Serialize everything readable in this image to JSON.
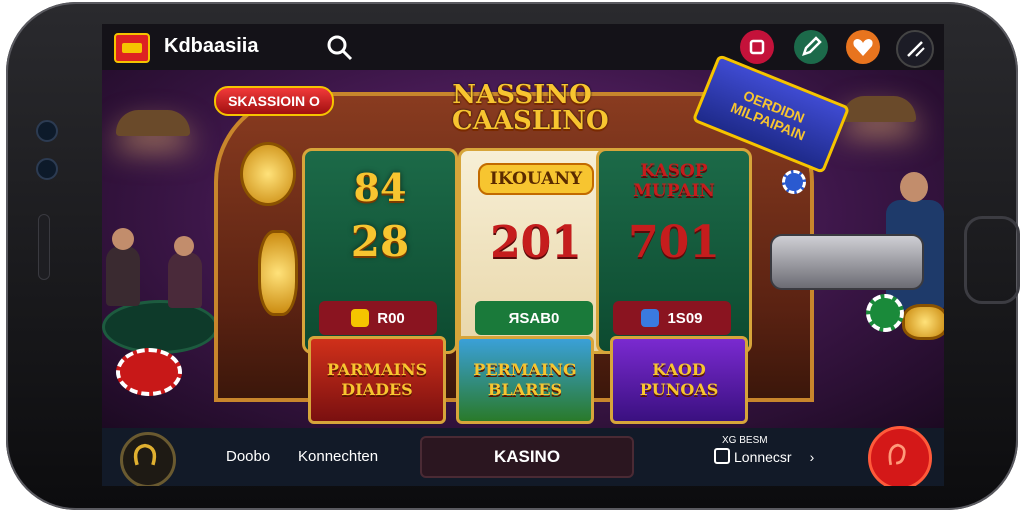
{
  "header": {
    "brand": "Kdbaasiia",
    "icons": [
      "stop-icon",
      "edit-icon",
      "heart-icon",
      "pen-icon"
    ]
  },
  "hero": {
    "session_banner": "SKASSIOIN O",
    "title_line1": "NASSINO",
    "title_line2": "CAASLINO",
    "promo_line1": "OERDIDN",
    "promo_line2": "MILPAIPAIN"
  },
  "reels": [
    {
      "top": "84",
      "bottom": "28",
      "pill": "R00"
    },
    {
      "banner": "IKOUANY",
      "value": "201",
      "pill": "ЯSAB0"
    },
    {
      "title1": "KASOP",
      "title2": "MUPAIN",
      "value": "701",
      "pill": "1S09"
    }
  ],
  "cards": [
    {
      "line1": "PARMAINS",
      "line2": "DIADES"
    },
    {
      "line1": "PERMAING",
      "line2": "BLARES"
    },
    {
      "line1": "KAOD",
      "line2": "PUNOAS"
    }
  ],
  "bottom_nav": {
    "item1": "Doobo",
    "item2": "Konnechten",
    "center": "KASINO",
    "conn_top": "XG BESM",
    "conn_main": "Lonnecsr"
  },
  "colors": {
    "topbar": "#141218",
    "bottom_bar": "#121a28",
    "gold": "#f7c530",
    "felt": "#0d4a30"
  }
}
